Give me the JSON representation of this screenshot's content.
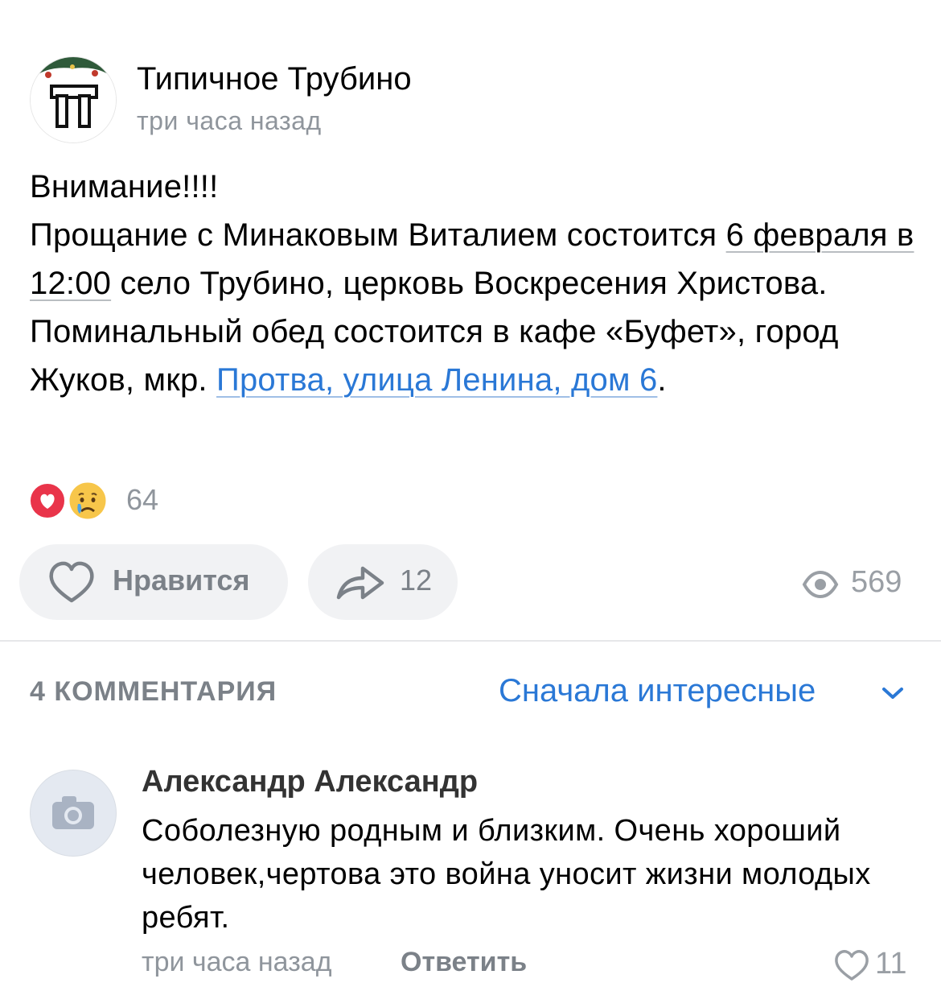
{
  "post": {
    "author": "Типичное Трубино",
    "logo_text": "ТТ",
    "time": "три часа назад",
    "line1": "Внимание!!!!",
    "line2_before": "Прощание с Минаковым Виталием состоится ",
    "line2_date": "6 февраля в 12:00",
    "line2_after": " село Трубино, церковь Воскресения Христова.",
    "line3_before": "Поминальный обед  состоится в кафе «Буфет», город Жуков, мкр. ",
    "line3_link": "Протва, улица Ленина, дом 6",
    "line3_after": "."
  },
  "reactions": {
    "icons": [
      "heart-reaction",
      "crying-face-reaction"
    ],
    "count": "64"
  },
  "actions": {
    "like_label": "Нравится",
    "share_count": "12",
    "views_count": "569"
  },
  "comments_header": {
    "count_label": "4 КОММЕНТАРИЯ",
    "sort_label": "Сначала интересные"
  },
  "comment": {
    "author": "Александр Александр",
    "text": "Соболезную родным и близким. Очень хороший человек,чертова это война уносит жизни молодых ребят.",
    "time": "три часа назад",
    "reply_label": "Ответить",
    "like_count": "11"
  },
  "colors": {
    "accent": "#2a78d6",
    "secondary_text": "#8f959c",
    "pill_bg": "#f1f2f4",
    "heart": "#e9344a"
  }
}
